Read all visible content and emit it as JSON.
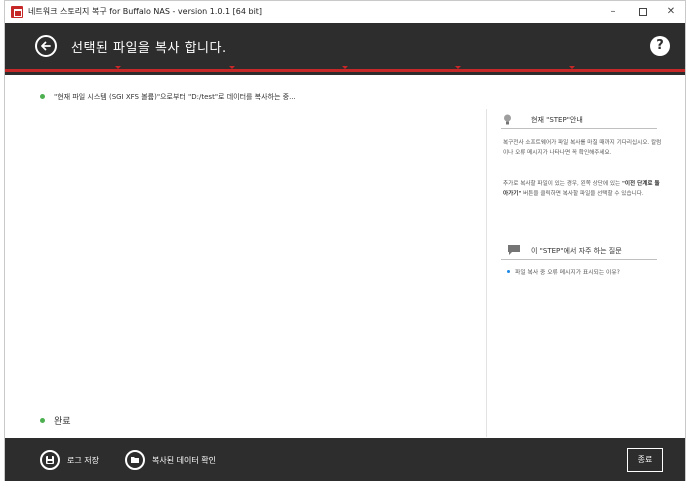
{
  "window": {
    "title": "네트워크 스토리지 복구 for Buffalo NAS - version 1.0.1 [64 bit]",
    "controls": {
      "minimize": "–",
      "maximize": "",
      "close": "✕"
    }
  },
  "header": {
    "back_icon": "back-arrow-icon",
    "title": "선택된 파일을 복사 합니다.",
    "help_label": "?"
  },
  "progress": {
    "steps_total": 6,
    "steps_completed": 6,
    "accent_color": "#c62828"
  },
  "log": {
    "line1": "\"현재 파일 시스템 (SGI XFS 볼륨)\"으로부터 \"D:/test\"로 데이터를 복사하는 중...",
    "done": "완료"
  },
  "sidebar": {
    "guide_title": "현재 \"STEP\"안내",
    "guide_p1": "복구전사 소프트웨어가 파일 복사를 마칠 때까지 기다리십시오. 칼럼이나 오류 메시지가 나타나면 꼭 확인해주세요.",
    "guide_p2_a": "추가로 복사할 파일이 있는 경우, 왼쪽 상단에 있는 ",
    "guide_p2_b": "\"이전 단계로 돌아가기\"",
    "guide_p2_c": " 버튼을 클릭하면 복사할 파일을 선택할 수 있습니다.",
    "faq_title": "이 \"STEP\"에서 자주 하는 질문",
    "faq_items": [
      "파일 복사 중 오류 메시지가 표시되는 이유?"
    ]
  },
  "footer": {
    "save_log": "로그 저장",
    "view_copied": "복사된 데이터 확인",
    "close": "종료"
  },
  "colors": {
    "dark_bar": "#2d2d2d",
    "accent": "#c62828",
    "status_green": "#4caf50",
    "faq_bullet": "#1e88e5"
  }
}
